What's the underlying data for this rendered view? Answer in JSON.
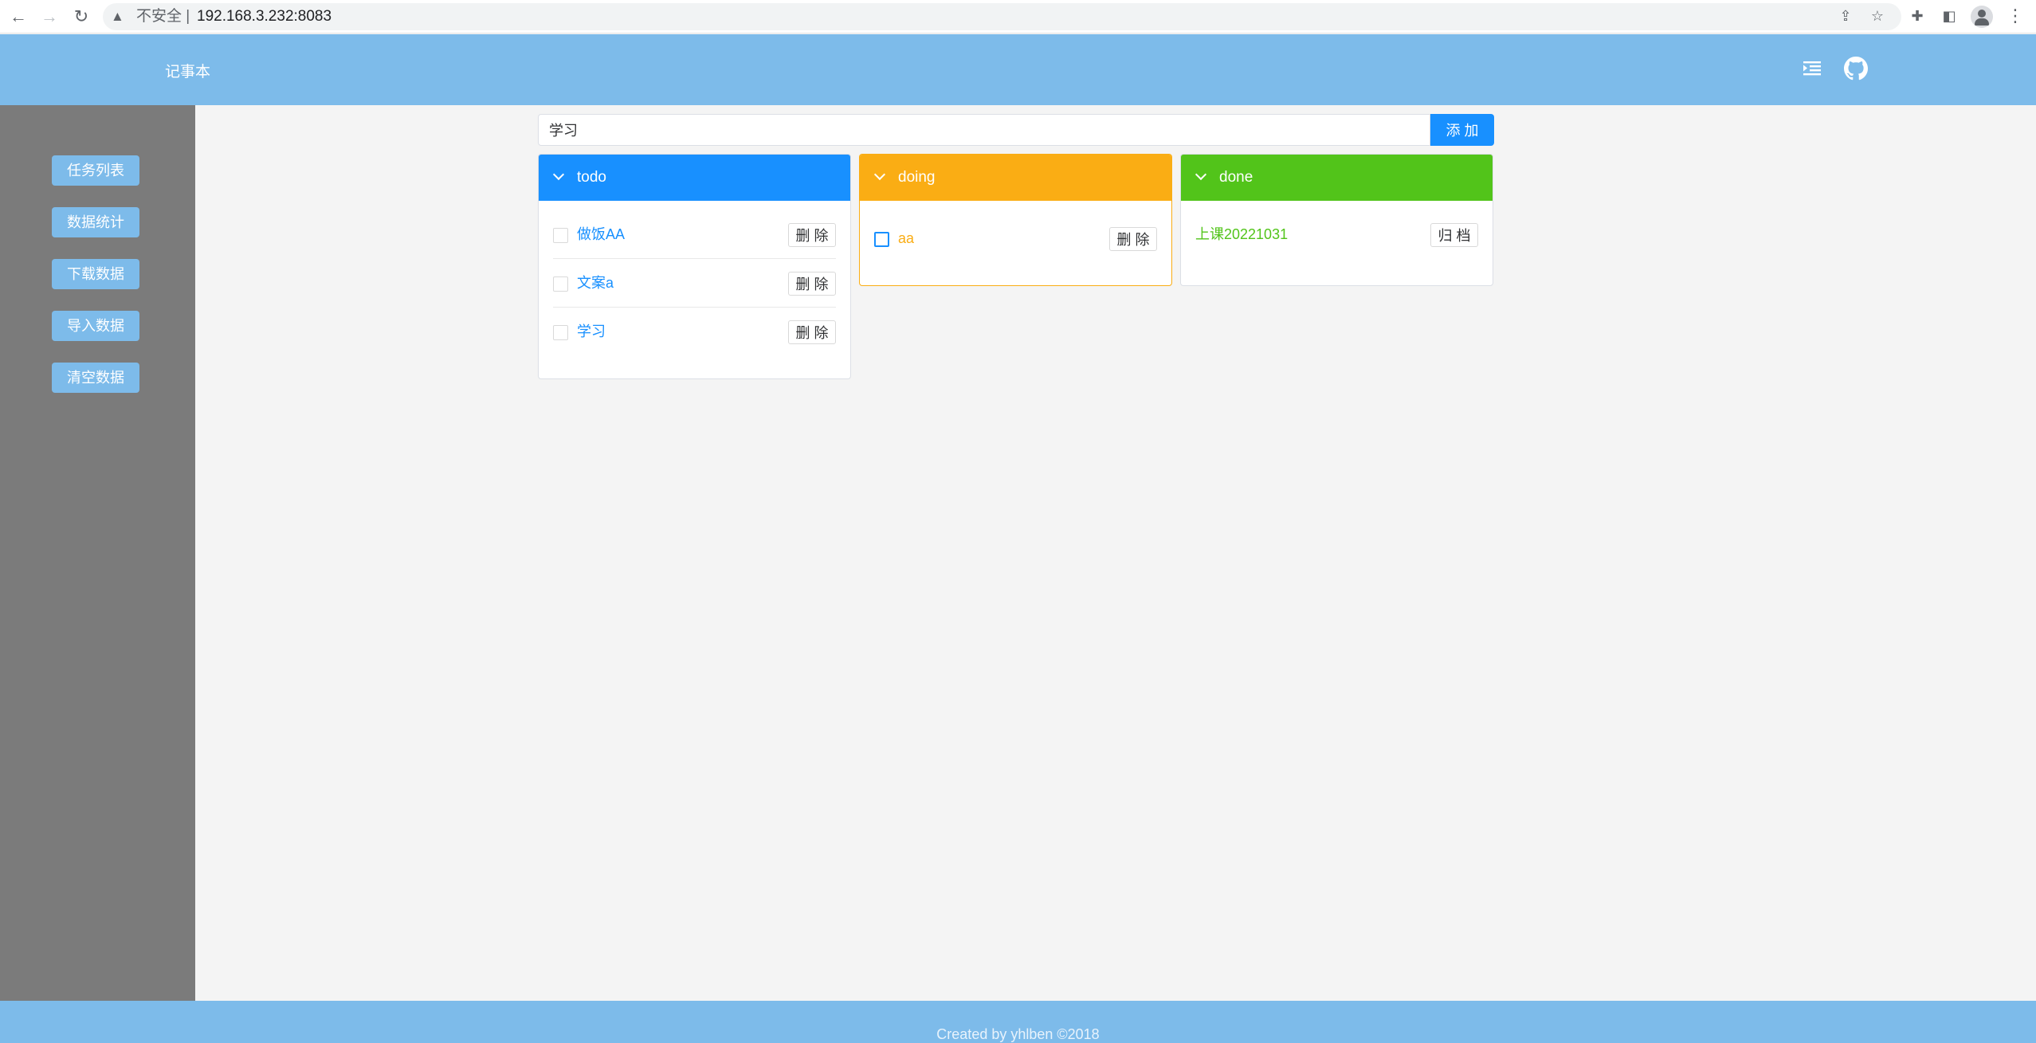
{
  "browser": {
    "back_icon": "back-arrow-icon",
    "forward_icon": "forward-arrow-icon",
    "reload_icon": "reload-icon",
    "security_label": "不安全 |",
    "url": "192.168.3.232:8083"
  },
  "header": {
    "title": "记事本",
    "icons": [
      "indent-menu-icon",
      "github-icon"
    ]
  },
  "sidebar": {
    "items": [
      {
        "label": "任务列表"
      },
      {
        "label": "数据统计"
      },
      {
        "label": "下载数据"
      },
      {
        "label": "导入数据"
      },
      {
        "label": "清空数据"
      }
    ]
  },
  "search": {
    "value": "学习",
    "add_label": "添 加"
  },
  "columns": {
    "todo": {
      "title": "todo",
      "color": "#1890ff",
      "items": [
        {
          "text": "做饭AA",
          "action": "删 除"
        },
        {
          "text": "文案a",
          "action": "删 除"
        },
        {
          "text": "学习",
          "action": "删 除"
        }
      ]
    },
    "doing": {
      "title": "doing",
      "color": "#faad14",
      "items": [
        {
          "text": "aa",
          "action": "删 除"
        }
      ]
    },
    "done": {
      "title": "done",
      "color": "#52c41a",
      "items": [
        {
          "text": "上课20221031",
          "action": "归 档"
        }
      ]
    }
  },
  "footer": {
    "text": "Created by yhlben ©2018"
  }
}
